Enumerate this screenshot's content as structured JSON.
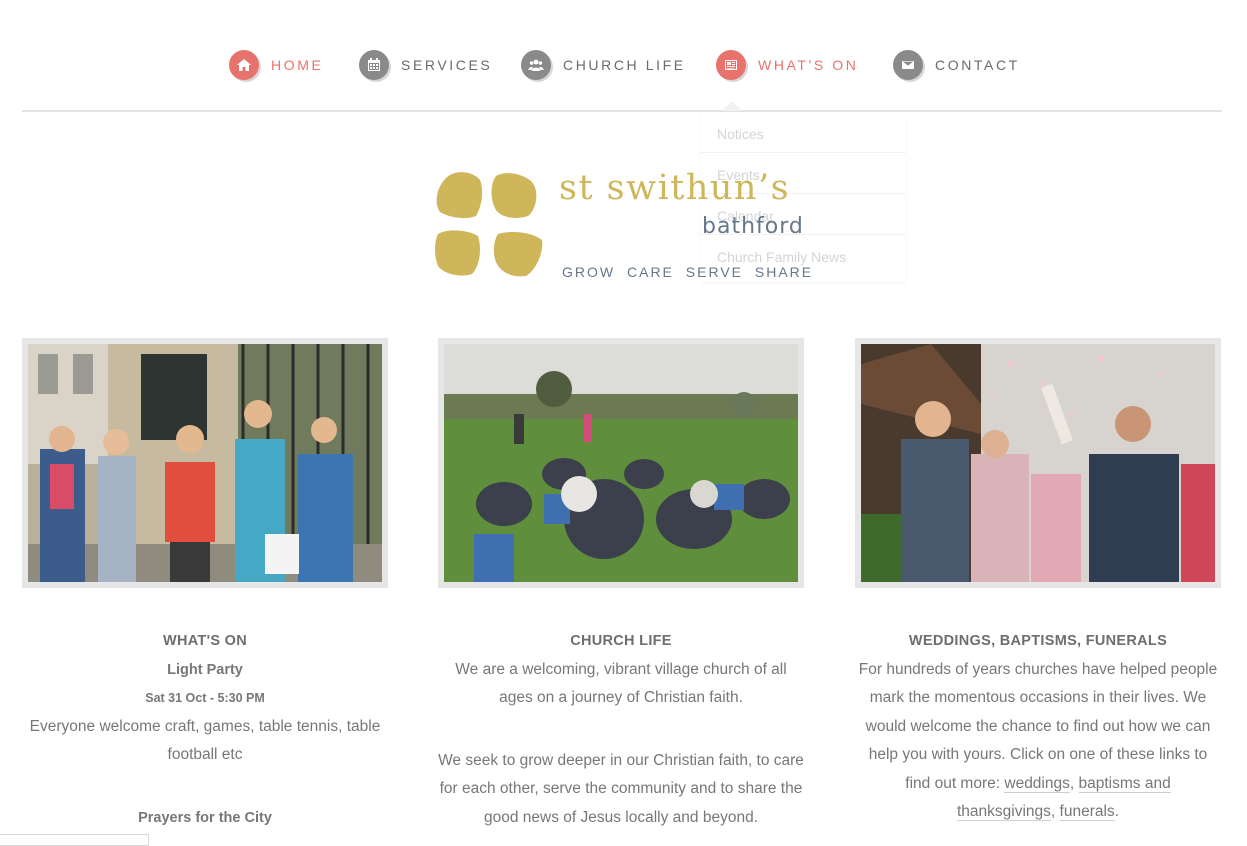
{
  "nav": {
    "items": [
      {
        "label": "HOME",
        "icon": "home-icon",
        "active": true
      },
      {
        "label": "SERVICES",
        "icon": "calendar-icon",
        "active": false
      },
      {
        "label": "CHURCH LIFE",
        "icon": "people-icon",
        "active": false
      },
      {
        "label": "WHAT'S ON",
        "icon": "newspaper-icon",
        "active": true
      },
      {
        "label": "CONTACT",
        "icon": "envelope-icon",
        "active": false
      }
    ],
    "accent_color": "#e8736c",
    "icon_color": "#8a8a8a"
  },
  "dropdown": {
    "items": [
      "Notices",
      "Events",
      "Calendar",
      "Church Family News"
    ]
  },
  "logo": {
    "name": "st swithun’s",
    "place": "bathford",
    "tagline": "GROW  CARE  SERVE  SHARE",
    "color": "#cfb65a"
  },
  "columns": [
    {
      "heading": "WHAT'S ON",
      "event_title": "Light Party",
      "event_date": "Sat 31 Oct - 5:30 PM",
      "event_desc": "Everyone welcome craft, games, table tennis, table football etc",
      "next_title": "Prayers for the City"
    },
    {
      "heading": "CHURCH LIFE",
      "para1": "We are a welcoming, vibrant village church of all ages on a journey of Christian faith.",
      "para2": "We seek to grow deeper in our Christian faith, to care for each other, serve the community and to share the good news of Jesus locally and beyond."
    },
    {
      "heading": "WEDDINGS, BAPTISMS, FUNERALS",
      "text": "For hundreds of years churches have helped people mark the momentous occasions in their lives. We would welcome the chance to find out how we can help you with yours. Click on one of these links to find out more:",
      "link_weddings": "weddings",
      "sep1": ",",
      "link_baptisms": "baptisms and thanksgivings",
      "sep2": ",",
      "link_funerals": "funerals",
      "end": "."
    }
  ]
}
